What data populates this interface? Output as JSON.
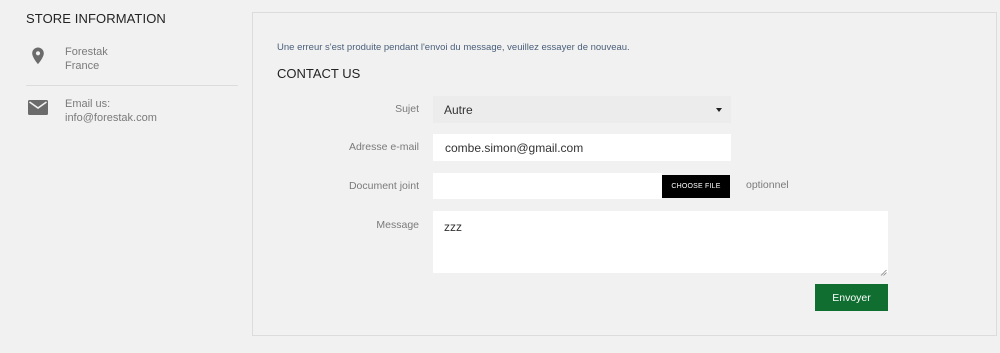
{
  "store": {
    "title": "STORE INFORMATION",
    "address": {
      "icon": "map-marker-icon",
      "line1": "Forestak",
      "line2": "France"
    },
    "email": {
      "icon": "envelope-icon",
      "label": "Email us:",
      "value": "info@forestak.com"
    }
  },
  "contact": {
    "alert": "Une erreur s'est produite pendant l'envoi du message, veuillez essayer de nouveau.",
    "title": "CONTACT US",
    "subject": {
      "label": "Sujet",
      "selected": "Autre"
    },
    "email": {
      "label": "Adresse e-mail",
      "value": "combe.simon@gmail.com"
    },
    "attachment": {
      "label": "Document joint",
      "button": "CHOOSE FILE",
      "note": "optionnel"
    },
    "message": {
      "label": "Message",
      "value": "zzz"
    },
    "submit": "Envoyer"
  },
  "colors": {
    "background": "#f1f1f1",
    "submit": "#0f6e30",
    "file_button": "#000000",
    "alert_text": "#4a5f7a"
  }
}
